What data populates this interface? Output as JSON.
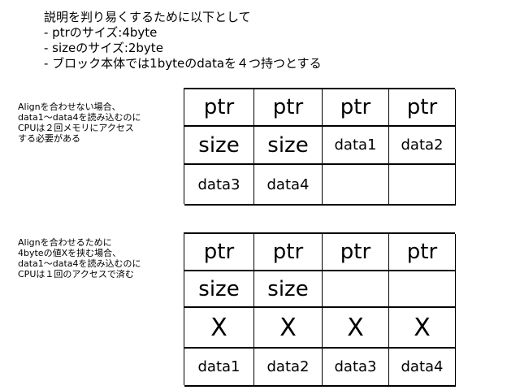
{
  "intro": {
    "line1": "説明を判り易くするために以下として",
    "line2": "- ptrのサイズ:4byte",
    "line3": "- sizeのサイズ:2byte",
    "line4": "- ブロック本体では1byteのdataを４つ持つとする"
  },
  "note1": {
    "line1": "Alignを合わせない場合、",
    "line2": "data1〜data4を読み込むのに",
    "line3": "CPUは２回メモリにアクセス",
    "line4": "する必要がある"
  },
  "note2": {
    "line1": "Alignを合わせるために",
    "line2": "4byteの値Xを挟む場合、",
    "line3": "data1〜data4を読み込むのに",
    "line4": "CPUは１回のアクセスで済む"
  },
  "grid1": {
    "rows": [
      [
        "ptr",
        "ptr",
        "ptr",
        "ptr"
      ],
      [
        "size",
        "size",
        "data1",
        "data2"
      ],
      [
        "data3",
        "data4",
        "",
        ""
      ]
    ]
  },
  "grid2": {
    "rows": [
      [
        "ptr",
        "ptr",
        "ptr",
        "ptr"
      ],
      [
        "size",
        "size",
        "",
        ""
      ],
      [
        "X",
        "X",
        "X",
        "X"
      ],
      [
        "data1",
        "data2",
        "data3",
        "data4"
      ]
    ]
  }
}
